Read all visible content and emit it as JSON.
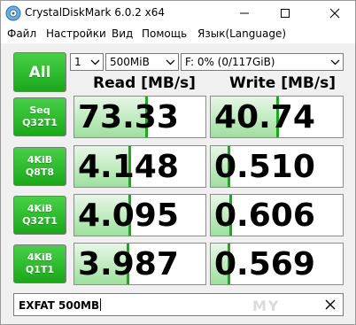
{
  "window": {
    "title": "CrystalDiskMark 6.0.2 x64"
  },
  "menu": [
    "Файл",
    "Настройки",
    "Вид",
    "Помощь",
    "Язык(Language)"
  ],
  "controls": {
    "all_label": "All",
    "test_count": "1",
    "test_size": "500MiB",
    "drive": "F: 0% (0/117GiB)"
  },
  "headers": {
    "read": "Read [MB/s]",
    "write": "Write [MB/s]"
  },
  "tests": [
    {
      "line1": "Seq",
      "line2": "Q32T1",
      "read": "73.33",
      "write": "40.74",
      "read_fill": 0.56,
      "write_fill": 0.52
    },
    {
      "line1": "4KiB",
      "line2": "Q8T8",
      "read": "4.148",
      "write": "0.510",
      "read_fill": 0.43,
      "write_fill": 0.15
    },
    {
      "line1": "4KiB",
      "line2": "Q32T1",
      "read": "4.095",
      "write": "0.606",
      "read_fill": 0.43,
      "write_fill": 0.16
    },
    {
      "line1": "4KiB",
      "line2": "Q1T1",
      "read": "3.987",
      "write": "0.569",
      "read_fill": 0.42,
      "write_fill": 0.15
    }
  ],
  "comment": {
    "value": "EXFAT 500MB"
  },
  "watermark": "MY",
  "colors": {
    "button_green": "#1aa81a",
    "bar_green": "#9ee09e"
  }
}
